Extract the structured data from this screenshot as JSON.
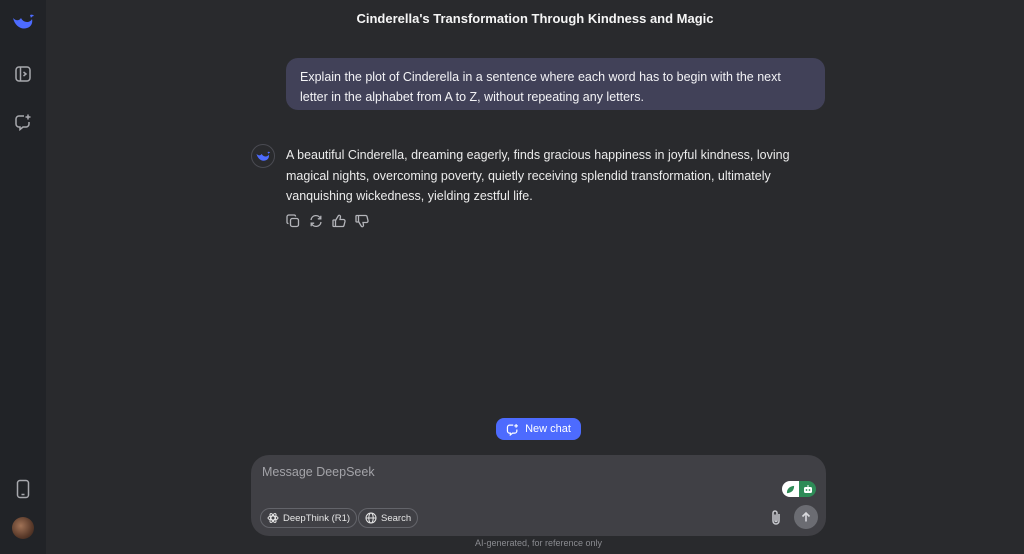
{
  "sidebar": {
    "logo_icon": "deepseek-whale-icon",
    "expand_icon": "sidebar-expand-icon",
    "new_chat_icon": "new-chat-icon",
    "mobile_icon": "mobile-phone-icon",
    "avatar": "user-avatar"
  },
  "chat": {
    "title": "Cinderella's Transformation Through Kindness and Magic",
    "user_message": "Explain the plot of Cinderella in a sentence where each word has to begin with the next letter in the alphabet from A to Z, without repeating any letters.",
    "assistant_message": "A beautiful Cinderella, dreaming eagerly, finds gracious happiness in joyful kindness, loving magical nights, overcoming poverty, quietly receiving splendid transformation, ultimately vanquishing wickedness, yielding zestful life.",
    "actions": [
      "copy-icon",
      "regenerate-icon",
      "thumbs-up-icon",
      "thumbs-down-icon"
    ]
  },
  "new_chat": {
    "label": "New chat"
  },
  "composer": {
    "placeholder": "Message DeepSeek",
    "deepthink_label": "DeepThink (R1)",
    "search_label": "Search"
  },
  "footer": {
    "disclaimer": "AI-generated, for reference only"
  },
  "colors": {
    "accent": "#4d6bfe",
    "background": "#292a2d",
    "sidebar": "#212327",
    "user_bubble": "#414158"
  }
}
